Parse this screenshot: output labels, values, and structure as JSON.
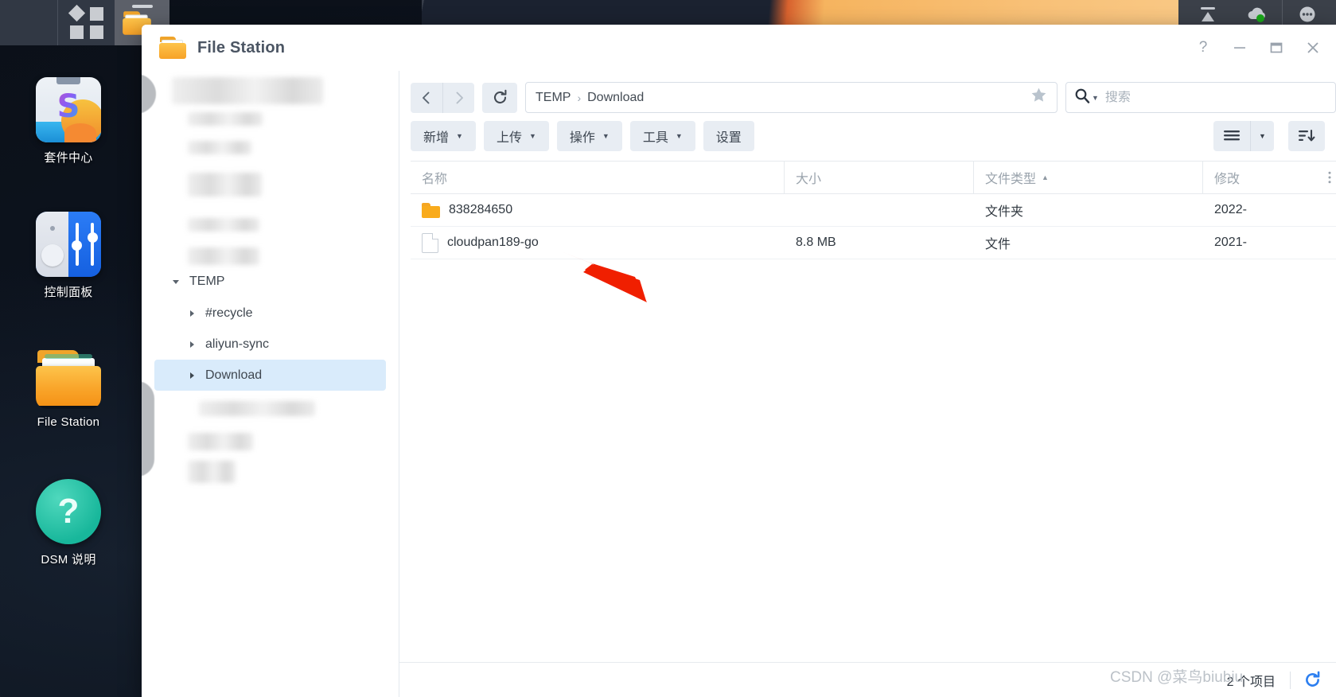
{
  "desktop": {
    "icons": [
      {
        "id": "package-center",
        "label": "套件中心"
      },
      {
        "id": "control-panel",
        "label": "控制面板"
      },
      {
        "id": "file-station",
        "label": "File Station"
      },
      {
        "id": "dsm-help",
        "label": "DSM 说明",
        "glyph": "?"
      }
    ]
  },
  "taskbar": {
    "main_menu_icon": "grid-icon",
    "open_apps": [
      {
        "name": "File Station",
        "icon": "folder-icon"
      }
    ],
    "tray": [
      "upload-icon",
      "cloud-sync-icon",
      "notifications-icon"
    ]
  },
  "window": {
    "title": "File Station",
    "controls": {
      "help": "?",
      "minimize": "—",
      "maximize": "□",
      "close": "×"
    }
  },
  "sidebar": {
    "tree": [
      {
        "label": "TEMP",
        "level": 1,
        "expanded": true,
        "selected": false,
        "caret": "caret-down-icon"
      },
      {
        "label": "#recycle",
        "level": 2,
        "expanded": false,
        "selected": false,
        "caret": "caret-right-icon"
      },
      {
        "label": "aliyun-sync",
        "level": 2,
        "expanded": false,
        "selected": false,
        "caret": "caret-right-icon"
      },
      {
        "label": "Download",
        "level": 2,
        "expanded": false,
        "selected": true,
        "caret": "caret-right-icon"
      }
    ],
    "redacted_rows": 9
  },
  "nav": {
    "back_icon": "chevron-left-icon",
    "forward_icon": "chevron-right-icon",
    "refresh_icon": "refresh-icon",
    "breadcrumb": {
      "root": "TEMP",
      "separator": "›",
      "current": "Download"
    },
    "favorite_icon": "star-icon"
  },
  "search": {
    "icon": "search-icon",
    "dropdown_icon": "caret-down-icon",
    "value": "",
    "placeholder": "搜索"
  },
  "toolbar": {
    "buttons": [
      {
        "label": "新增",
        "has_menu": true
      },
      {
        "label": "上传",
        "has_menu": true
      },
      {
        "label": "操作",
        "has_menu": true
      },
      {
        "label": "工具",
        "has_menu": true
      },
      {
        "label": "设置",
        "has_menu": false
      }
    ],
    "view_mode_icon": "list-view-icon",
    "view_mode_dropdown_icon": "caret-down-icon",
    "sort_icon": "sort-descending-icon"
  },
  "file_table": {
    "columns": [
      {
        "key": "name",
        "label": "名称",
        "sorted": false
      },
      {
        "key": "size",
        "label": "大小",
        "sorted": false
      },
      {
        "key": "type",
        "label": "文件类型",
        "sorted": true,
        "sort_dir": "asc",
        "sort_icon": "caret-up-icon"
      },
      {
        "key": "mod",
        "label": "修改",
        "sorted": false,
        "menu_icon": "kebab-icon"
      }
    ],
    "rows": [
      {
        "icon": "folder-icon",
        "name": "838284650",
        "size": "",
        "type": "文件夹",
        "modified": "2022-"
      },
      {
        "icon": "file-icon",
        "name": "cloudpan189-go",
        "size": "8.8 MB",
        "type": "文件",
        "modified": "2021-"
      }
    ]
  },
  "status": {
    "item_count": "2 个项目",
    "refresh_icon": "refresh-icon"
  },
  "annotation": {
    "arrow_color": "#f01f00",
    "points_to": "cloudpan189-go"
  },
  "watermark": {
    "text": "CSDN @菜鸟biubiu"
  },
  "colors": {
    "accent_blue": "#2d7ff0",
    "selection": "#d9ebfb",
    "toolbar_button": "#e8edf3",
    "folder_orange": "#f9ab1c",
    "arrow_red": "#f01f00"
  }
}
